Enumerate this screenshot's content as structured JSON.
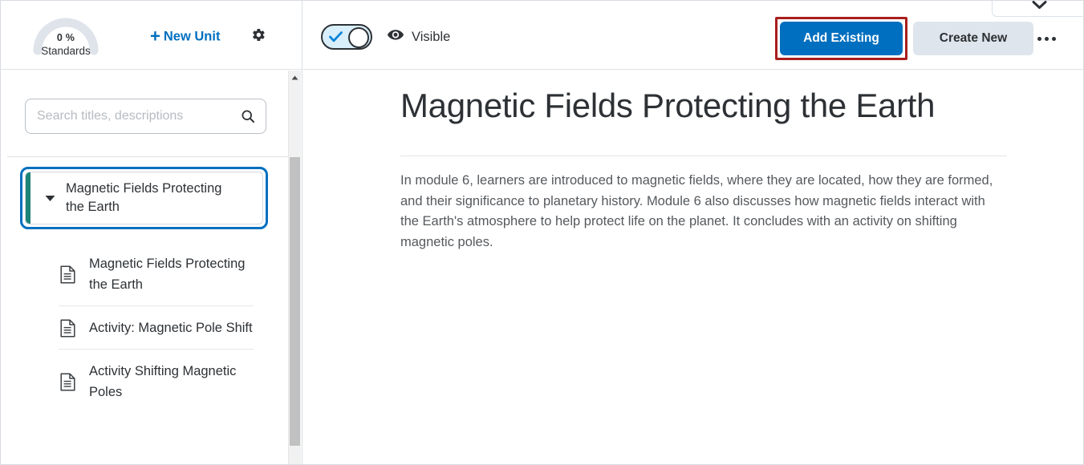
{
  "sidebar": {
    "gauge": {
      "percent": "0 %",
      "label": "Standards",
      "value": 0,
      "track_color": "#dfe3ea"
    },
    "new_unit": {
      "plus": "+",
      "label": "New Unit",
      "icon": "plus-icon",
      "color": "#006fbf"
    },
    "settings": {
      "icon": "gear-icon"
    },
    "search": {
      "placeholder": "Search titles, descriptions",
      "value": "",
      "icon": "search-icon"
    },
    "scrollbar": {
      "up_arrow_icon": "caret-up-icon"
    },
    "tree": {
      "unit": {
        "title": "Magnetic Fields Protecting the Earth",
        "expanded": true,
        "caret_icon": "caret-down-icon",
        "selected": true,
        "accent_color": "#1c8378",
        "focus_ring_color": "#006fbf"
      },
      "children": [
        {
          "label": "Magnetic Fields Protecting the Earth",
          "icon": "document-icon"
        },
        {
          "label": "Activity: Magnetic Pole Shift",
          "icon": "document-icon"
        },
        {
          "label": "Activity Shifting Magnetic Poles",
          "icon": "document-icon"
        }
      ]
    }
  },
  "toolbar": {
    "visibility_toggle": {
      "state": "on",
      "check_icon": "check-icon",
      "knob": "toggle-knob"
    },
    "visibility_status": {
      "icon": "eye-icon",
      "label": "Visible"
    },
    "add_existing": {
      "label": "Add Existing",
      "color": "#006fbf",
      "highlighted": true,
      "highlight_color": "#a81e1e"
    },
    "create_new": {
      "label": "Create New",
      "color": "#dfe5ec"
    },
    "more_menu": {
      "icon": "ellipsis-icon"
    },
    "top_dropdown": {
      "icon": "chevron-down-icon"
    }
  },
  "main": {
    "title": "Magnetic Fields Protecting the Earth",
    "description": "In module 6, learners are introduced to magnetic fields, where they are located, how they are formed, and their significance to planetary history. Module 6 also discusses how magnetic fields interact with the Earth's atmosphere to help protect life on the planet. It concludes with an activity on shifting magnetic poles."
  }
}
